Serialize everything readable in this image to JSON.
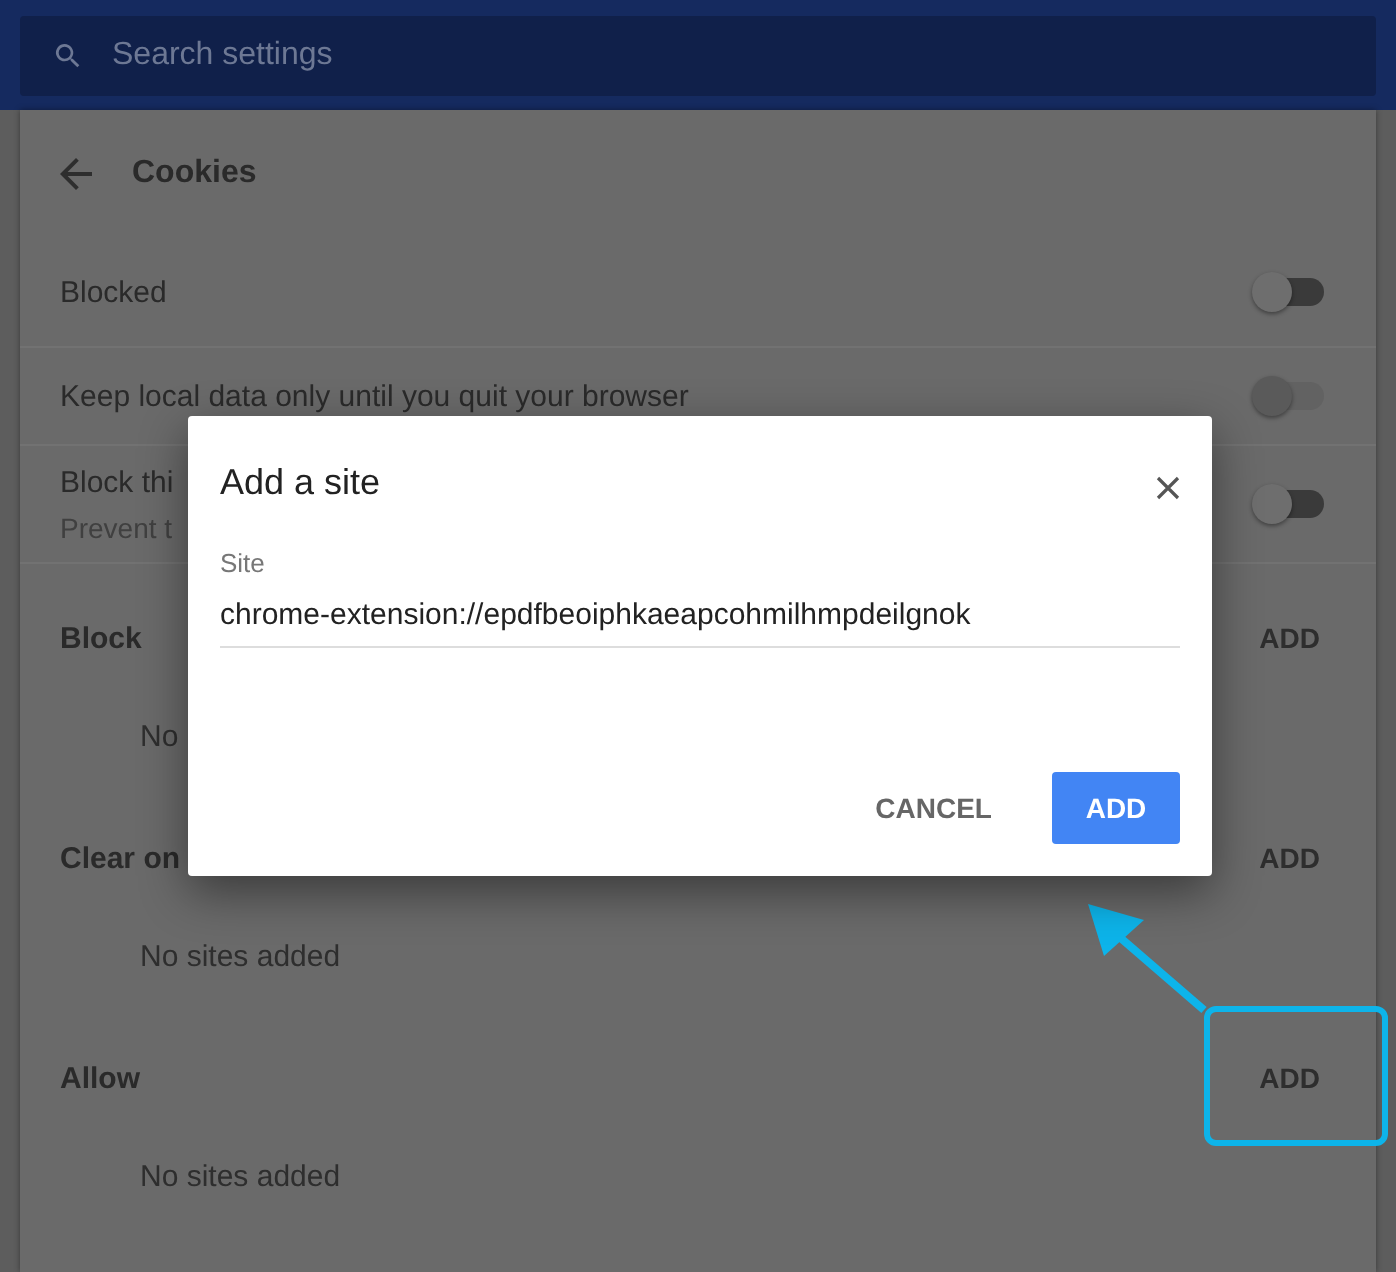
{
  "header": {
    "search": {
      "placeholder": "Search settings"
    }
  },
  "page": {
    "title": "Cookies"
  },
  "settings": [
    {
      "kind": "toggle",
      "label": "Blocked",
      "on": false,
      "disabled": false
    },
    {
      "kind": "toggle",
      "label": "Keep local data only until you quit your browser",
      "on": false,
      "disabled": true
    },
    {
      "kind": "toggle",
      "label": "Block thi",
      "sublabel": "Prevent t",
      "on": false,
      "disabled": false
    }
  ],
  "lists": [
    {
      "title": "Block",
      "action": "ADD",
      "empty": "No"
    },
    {
      "title": "Clear on",
      "action": "ADD",
      "empty": "No sites added"
    },
    {
      "title": "Allow",
      "action": "ADD",
      "empty": "No sites added",
      "highlighted": true
    }
  ],
  "dialog": {
    "title": "Add a site",
    "field_label": "Site",
    "value": "chrome-extension://epdfbeoiphkaeapcohmilhmpdeilgnok",
    "cancel": "CANCEL",
    "confirm": "ADD"
  }
}
